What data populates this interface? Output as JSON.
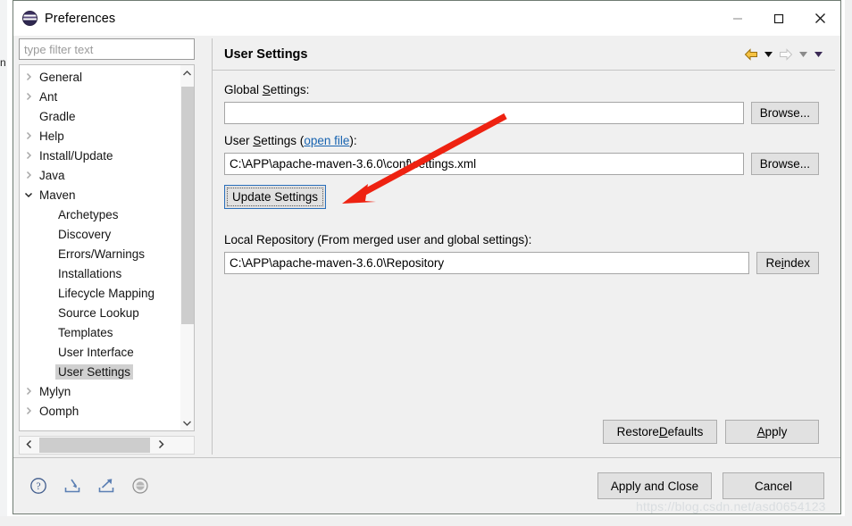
{
  "window": {
    "title": "Preferences",
    "logo_icon": "eclipse-logo-icon",
    "minimize_label": "Minimize",
    "maximize_label": "Maximize",
    "close_label": "Close"
  },
  "sidebar": {
    "filter": {
      "value": "",
      "placeholder": "type filter text"
    },
    "items": [
      {
        "label": "General",
        "level": 0,
        "expandable": true,
        "expanded": false,
        "selected": false
      },
      {
        "label": "Ant",
        "level": 0,
        "expandable": true,
        "expanded": false,
        "selected": false
      },
      {
        "label": "Gradle",
        "level": 0,
        "expandable": false,
        "expanded": false,
        "selected": false
      },
      {
        "label": "Help",
        "level": 0,
        "expandable": true,
        "expanded": false,
        "selected": false
      },
      {
        "label": "Install/Update",
        "level": 0,
        "expandable": true,
        "expanded": false,
        "selected": false
      },
      {
        "label": "Java",
        "level": 0,
        "expandable": true,
        "expanded": false,
        "selected": false
      },
      {
        "label": "Maven",
        "level": 0,
        "expandable": true,
        "expanded": true,
        "selected": false
      },
      {
        "label": "Archetypes",
        "level": 1,
        "expandable": false,
        "expanded": false,
        "selected": false
      },
      {
        "label": "Discovery",
        "level": 1,
        "expandable": false,
        "expanded": false,
        "selected": false
      },
      {
        "label": "Errors/Warnings",
        "level": 1,
        "expandable": false,
        "expanded": false,
        "selected": false
      },
      {
        "label": "Installations",
        "level": 1,
        "expandable": false,
        "expanded": false,
        "selected": false
      },
      {
        "label": "Lifecycle Mapping",
        "level": 1,
        "expandable": false,
        "expanded": false,
        "selected": false
      },
      {
        "label": "Source Lookup",
        "level": 1,
        "expandable": false,
        "expanded": false,
        "selected": false
      },
      {
        "label": "Templates",
        "level": 1,
        "expandable": false,
        "expanded": false,
        "selected": false
      },
      {
        "label": "User Interface",
        "level": 1,
        "expandable": false,
        "expanded": false,
        "selected": false
      },
      {
        "label": "User Settings",
        "level": 1,
        "expandable": false,
        "expanded": false,
        "selected": true
      },
      {
        "label": "Mylyn",
        "level": 0,
        "expandable": true,
        "expanded": false,
        "selected": false
      },
      {
        "label": "Oomph",
        "level": 0,
        "expandable": true,
        "expanded": false,
        "selected": false
      }
    ],
    "scroll": {
      "up_arrow_icon": "chevron-up-icon",
      "down_arrow_icon": "chevron-down-icon",
      "left_arrow_icon": "chevron-left-icon",
      "right_arrow_icon": "chevron-right-icon"
    }
  },
  "pane": {
    "title": "User Settings",
    "nav": {
      "back_icon": "back-arrow-icon",
      "back_menu_icon": "caret-down-icon",
      "forward_icon": "forward-arrow-icon",
      "forward_menu_icon": "caret-down-icon",
      "view_menu_icon": "caret-down-icon"
    },
    "global_settings": {
      "label_pre": "Global ",
      "label_mn": "S",
      "label_post": "ettings:",
      "value": "",
      "browse_label": "Browse..."
    },
    "user_settings": {
      "label_pre": "User ",
      "label_mn": "S",
      "label_mid": "ettings (",
      "link_label": "open file",
      "label_post": "):",
      "value": "C:\\APP\\apache-maven-3.6.0\\conf\\settings.xml",
      "browse_label": "Browse...",
      "update_label": "Update Settings"
    },
    "local_repository": {
      "label": "Local Repository (From merged user and global settings):",
      "value": "C:\\APP\\apache-maven-3.6.0\\Repository",
      "reindex_pre": "Re",
      "reindex_mn": "i",
      "reindex_post": "ndex"
    },
    "restore_defaults": {
      "pre": "Restore ",
      "mn": "D",
      "post": "efaults"
    },
    "apply": {
      "pre": "",
      "mn": "A",
      "post": "pply"
    }
  },
  "footer": {
    "icons": [
      {
        "name": "help-icon",
        "title": "Help"
      },
      {
        "name": "import-icon",
        "title": "Import"
      },
      {
        "name": "export-icon",
        "title": "Export"
      },
      {
        "name": "oomph-recorder-icon",
        "title": "Record preference changes"
      }
    ],
    "apply_and_close_label": "Apply and Close",
    "cancel_label": "Cancel"
  },
  "annotation": {
    "arrow_color": "#ee2211",
    "target": "update-settings-button"
  },
  "watermark": {
    "text": "https://blog.csdn.net/asd0654123"
  },
  "backdrop": {
    "left_text": "n"
  }
}
